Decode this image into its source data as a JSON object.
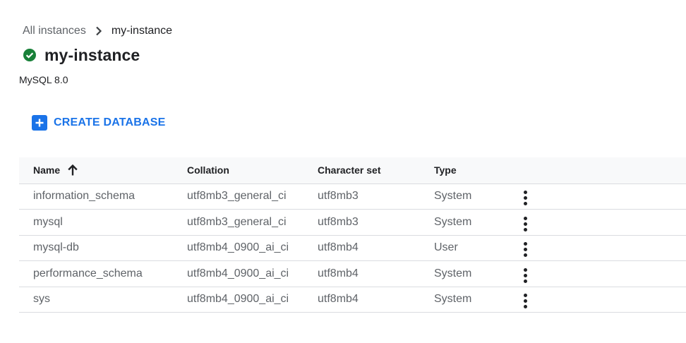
{
  "breadcrumb": {
    "parent": "All instances",
    "current": "my-instance"
  },
  "header": {
    "title": "my-instance",
    "subtitle": "MySQL 8.0",
    "status_icon": "check-circle-icon",
    "status_color": "#188038"
  },
  "toolbar": {
    "create_label": "CREATE DATABASE",
    "accent_color": "#1a73e8"
  },
  "table": {
    "columns": {
      "name": "Name",
      "collation": "Collation",
      "charset": "Character set",
      "type": "Type"
    },
    "sort": {
      "column": "Name",
      "direction": "ascending"
    },
    "rows": [
      {
        "name": "information_schema",
        "collation": "utf8mb3_general_ci",
        "charset": "utf8mb3",
        "type": "System"
      },
      {
        "name": "mysql",
        "collation": "utf8mb3_general_ci",
        "charset": "utf8mb3",
        "type": "System"
      },
      {
        "name": "mysql-db",
        "collation": "utf8mb4_0900_ai_ci",
        "charset": "utf8mb4",
        "type": "User"
      },
      {
        "name": "performance_schema",
        "collation": "utf8mb4_0900_ai_ci",
        "charset": "utf8mb4",
        "type": "System"
      },
      {
        "name": "sys",
        "collation": "utf8mb4_0900_ai_ci",
        "charset": "utf8mb4",
        "type": "System"
      }
    ]
  }
}
